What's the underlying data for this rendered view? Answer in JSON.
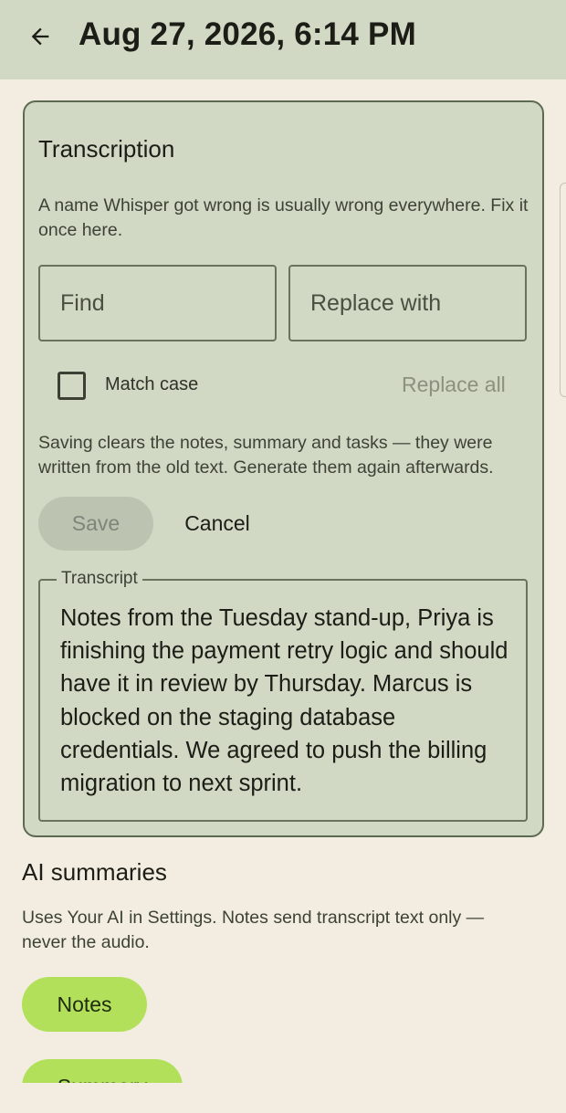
{
  "header": {
    "title": "Aug 27, 2026, 6:14 PM"
  },
  "transcription": {
    "title": "Transcription",
    "description": "A name Whisper got wrong is usually wrong everywhere. Fix it once here.",
    "find_placeholder": "Find",
    "replace_placeholder": "Replace with",
    "match_case_label": "Match case",
    "match_case_checked": false,
    "replace_all_label": "Replace all",
    "warning": "Saving clears the notes, summary and tasks — they were written from the old text. Generate them again afterwards.",
    "save_label": "Save",
    "cancel_label": "Cancel",
    "transcript_label": "Transcript",
    "transcript_text": "Notes from the Tuesday stand-up, Priya is finishing the payment retry logic and should have it in review by Thursday. Marcus is blocked on the staging database credentials. We agreed to push the billing migration to next sprint."
  },
  "ai_summaries": {
    "title": "AI summaries",
    "description": "Uses Your AI in Settings. Notes send transcript text only — never the audio.",
    "notes_label": "Notes",
    "summary_label": "Summary"
  },
  "colors": {
    "background": "#f3ede1",
    "surface": "#d1d8c3",
    "outline": "#5d6a52",
    "accent": "#b3e05a",
    "disabled": "#bcc3b1"
  }
}
